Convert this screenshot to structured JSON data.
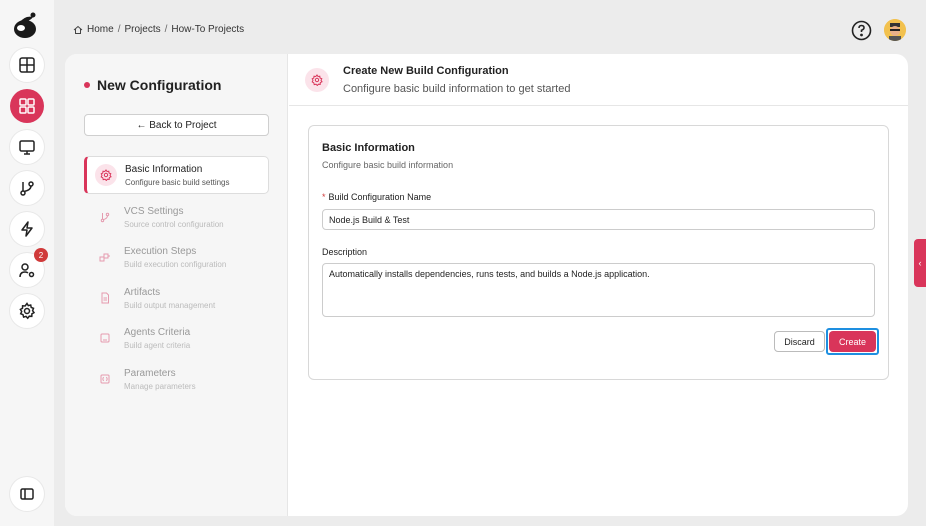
{
  "breadcrumb": {
    "items": [
      "Home",
      "Projects",
      "How-To Projects"
    ],
    "separator": "/"
  },
  "rail": {
    "items": [
      {
        "icon": "layout-icon"
      },
      {
        "icon": "dashboard-grid-icon",
        "active": true
      },
      {
        "icon": "monitor-icon"
      },
      {
        "icon": "git-branch-icon"
      },
      {
        "icon": "lightning-icon"
      },
      {
        "icon": "user-settings-icon",
        "badge": "2"
      },
      {
        "icon": "gear-icon"
      }
    ]
  },
  "left_panel": {
    "title": "New Configuration",
    "back_label": "← Back to Project",
    "steps": [
      {
        "title": "Basic Information",
        "subtitle": "Configure basic build settings",
        "active": true
      },
      {
        "title": "VCS Settings",
        "subtitle": "Source control configuration"
      },
      {
        "title": "Execution Steps",
        "subtitle": "Build execution configuration"
      },
      {
        "title": "Artifacts",
        "subtitle": "Build output management"
      },
      {
        "title": "Agents Criteria",
        "subtitle": "Build agent criteria"
      },
      {
        "title": "Parameters",
        "subtitle": "Manage parameters"
      }
    ]
  },
  "header": {
    "title": "Create New Build Configuration",
    "subtitle": "Configure basic build information to get started"
  },
  "form": {
    "section_title": "Basic Information",
    "section_subtitle": "Configure basic build information",
    "name_label": "Build Configuration Name",
    "name_required": "*",
    "name_value": "Node.js Build & Test",
    "description_label": "Description",
    "description_value": "Automatically installs dependencies, runs tests, and builds a Node.js application.",
    "discard_label": "Discard",
    "create_label": "Create"
  },
  "colors": {
    "accent": "#d9355a",
    "focus": "#1e8fe0"
  }
}
